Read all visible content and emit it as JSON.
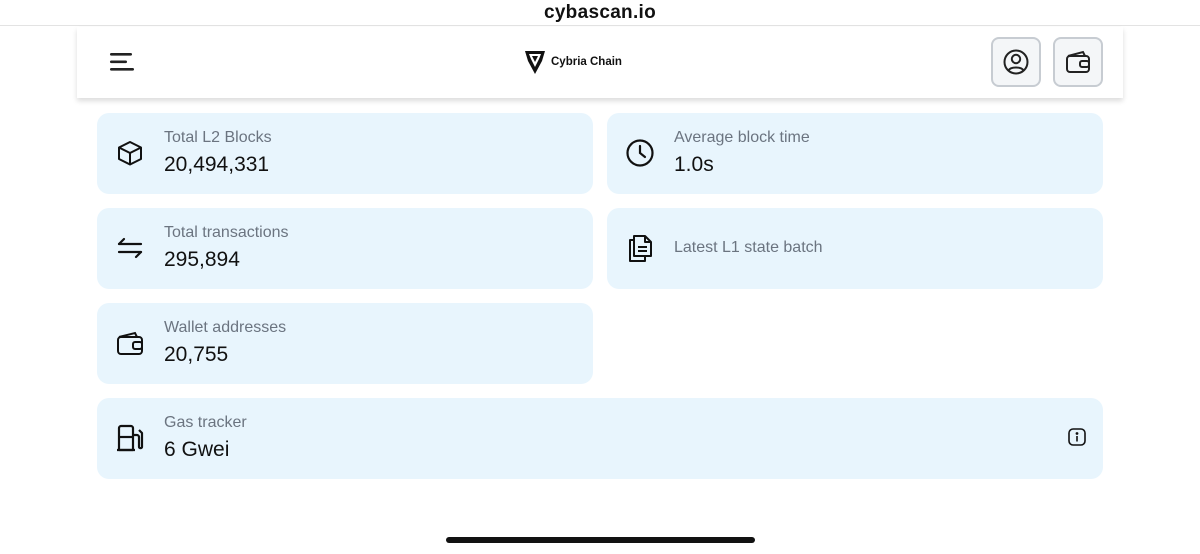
{
  "browser": {
    "url": "cybascan.io"
  },
  "header": {
    "logo_text": "Cybria Chain"
  },
  "icons": {
    "menu": "hamburger-menu-icon",
    "profile": "user-circle-icon",
    "wallet": "wallet-icon"
  },
  "stats": {
    "blocks": {
      "label": "Total L2 Blocks",
      "value": "20,494,331"
    },
    "block_time": {
      "label": "Average block time",
      "value": "1.0s"
    },
    "transactions": {
      "label": "Total transactions",
      "value": "295,894"
    },
    "state_batch": {
      "label": "Latest L1 state batch"
    },
    "wallets": {
      "label": "Wallet addresses",
      "value": "20,755"
    },
    "gas": {
      "label": "Gas tracker",
      "value": "6 Gwei"
    }
  },
  "colors": {
    "card_bg": "#e8f5fd",
    "label": "#6b7480",
    "value": "#111111"
  }
}
